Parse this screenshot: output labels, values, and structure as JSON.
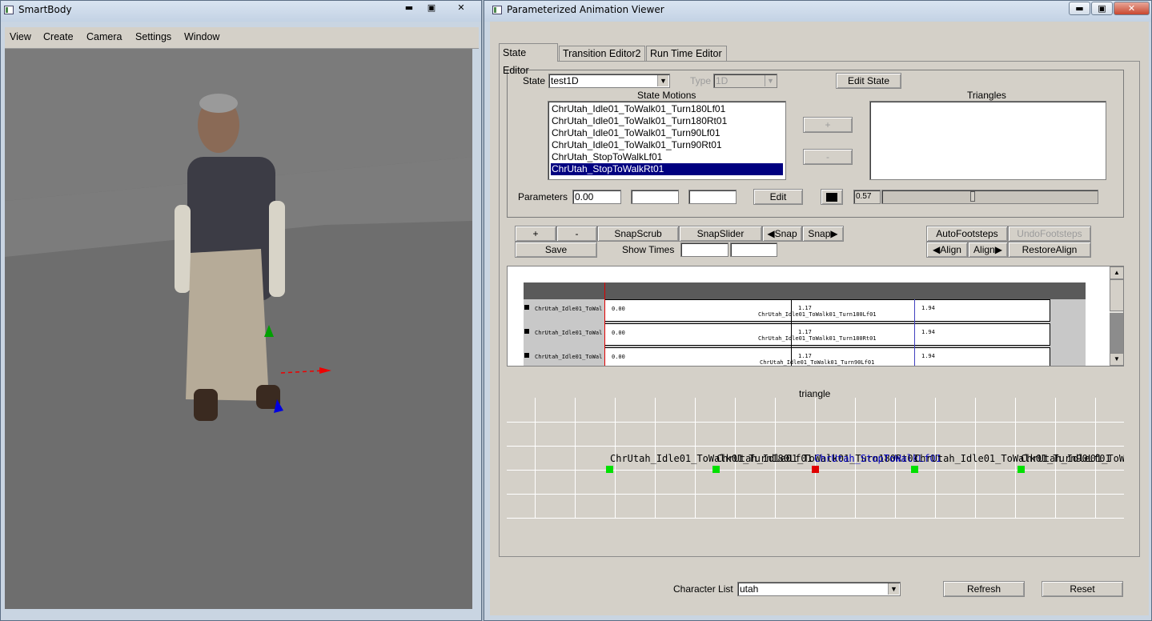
{
  "smartbody": {
    "title": "SmartBody",
    "menu": [
      "View",
      "Create",
      "Camera",
      "Settings",
      "Window"
    ]
  },
  "viewer": {
    "title": "Parameterized Animation Viewer",
    "tabs": [
      "State Editor",
      "Transition Editor2",
      "Run Time Editor"
    ],
    "state_label": "State",
    "state_value": "test1D",
    "type_label": "Type",
    "type_value": "1D",
    "edit_state_label": "Edit State",
    "state_motions_label": "State Motions",
    "triangles_label": "Triangles",
    "motions": [
      "ChrUtah_Idle01_ToWalk01_Turn180Lf01",
      "ChrUtah_Idle01_ToWalk01_Turn180Rt01",
      "ChrUtah_Idle01_ToWalk01_Turn90Lf01",
      "ChrUtah_Idle01_ToWalk01_Turn90Rt01",
      "ChrUtah_StopToWalkLf01",
      "ChrUtah_StopToWalkRt01"
    ],
    "add_label": "+",
    "remove_label": "-",
    "parameters_label": "Parameters",
    "param_value": "0.00",
    "edit_label": "Edit",
    "slider_value": "0.57",
    "slider_level": 0.57,
    "toolbar": {
      "plus": "+",
      "minus": "-",
      "snapscrub": "SnapScrub",
      "snapslider": "SnapSlider",
      "snap_left": "Snap",
      "snap_right": "Snap",
      "autofootsteps": "AutoFootsteps",
      "undofootsteps": "UndoFootsteps",
      "save": "Save",
      "show_times": "Show Times",
      "align_left": "Align",
      "align_right": "Align",
      "restorealign": "RestoreAlign"
    },
    "timeline_rows": [
      {
        "label": "ChrUtah_Idle01_ToWalk01_Turn180Lf01",
        "t0": "0.00",
        "t1": "1.17",
        "t2": "1.94",
        "name": "ChrUtah_Idle01_ToWalk01_Turn180Lf01"
      },
      {
        "label": "ChrUtah_Idle01_ToWalk01_Turn180Rt01",
        "t0": "0.00",
        "t1": "1.17",
        "t2": "1.94",
        "name": "ChrUtah_Idle01_ToWalk01_Turn180Rt01"
      },
      {
        "label": "ChrUtah_Idle01_ToWalk01_Turn90Lf01",
        "t0": "0.00",
        "t1": "1.17",
        "t2": "1.94",
        "name": "ChrUtah_Idle01_ToWalk01_Turn90Lf01"
      }
    ],
    "triangle_label": "triangle",
    "plot_labels": [
      "ChrUtah_Idle01_ToWalk01_Turn180Lf01",
      "ChrUtah_Idle01_ToWalk01_Turn180Rt01",
      "ChrUtah_StopToWalkLf01",
      "ChrUtah_Idle01_ToWalk01_Turn90Lf01",
      "ChrUtah_Idle01_ToWalk01_Turn90Rt01"
    ],
    "plot_colors": {
      "normal": "#00e000",
      "selected": "#e00000",
      "highlight_text": "#0000c0"
    },
    "character_list_label": "Character List",
    "character_value": "utah",
    "refresh_label": "Refresh",
    "reset_label": "Reset"
  }
}
